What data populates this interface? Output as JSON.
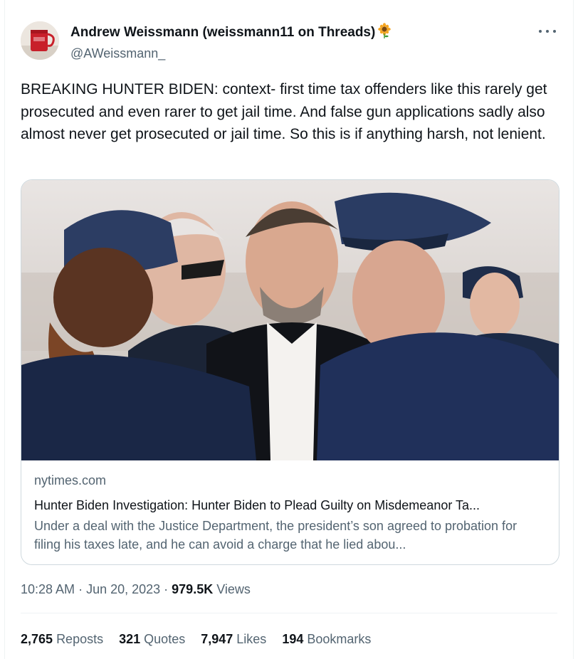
{
  "author": {
    "name": "Andrew Weissmann (weissmann11 on Threads)",
    "handle": "@AWeissmann_",
    "name_emoji_icon": "sunflower-icon",
    "avatar_icon": "red-mug-avatar"
  },
  "tweet": {
    "text": "BREAKING HUNTER BIDEN: context- first time tax offenders like this rarely get prosecuted and even rarer to get jail time. And false gun applications sadly also almost never get prosecuted or jail time. So this is if anything harsh, not lenient."
  },
  "link_card": {
    "domain": "nytimes.com",
    "title": "Hunter Biden Investigation: Hunter Biden to Plead Guilty on Misdemeanor Ta...",
    "description": "Under a deal with the Justice Department, the president’s son agreed to probation for filing his taxes late, and he can avoid a charge that he lied abou..."
  },
  "meta": {
    "time": "10:28 AM",
    "date": "Jun 20, 2023",
    "views_count": "979.5K",
    "views_label": "Views"
  },
  "stats": {
    "reposts_count": "2,765",
    "reposts_label": "Reposts",
    "quotes_count": "321",
    "quotes_label": "Quotes",
    "likes_count": "7,947",
    "likes_label": "Likes",
    "bookmarks_count": "194",
    "bookmarks_label": "Bookmarks"
  },
  "colors": {
    "text_primary": "#0f1419",
    "text_secondary": "#536471",
    "border": "#cfd9de"
  }
}
